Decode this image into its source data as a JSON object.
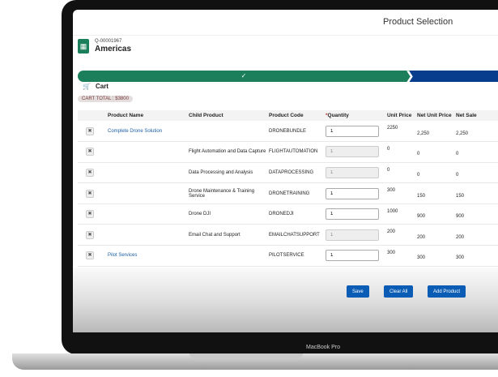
{
  "header": {
    "title": "Product Selection"
  },
  "record": {
    "quote_number": "Q-00001967",
    "account": "Americas"
  },
  "progress": {
    "completed_icon": "check-icon"
  },
  "cart": {
    "label": "Cart",
    "total": "CART TOTAL : $3800"
  },
  "table": {
    "columns": [
      "",
      "Product Name",
      "Child Product",
      "Product Code",
      "Quantity",
      "Unit Price",
      "Net Unit Price",
      "Net Sale"
    ],
    "required_mark": "*",
    "rows": [
      {
        "product": "Complete Drone Solution",
        "child": "",
        "code": "DRONEBUNDLE",
        "qty": "1",
        "qty_editable": true,
        "unit": "2250",
        "net_unit": "2,250",
        "net_sale": "2,250"
      },
      {
        "product": "",
        "child": "Flight Automation and Data Capture",
        "code": "FLIGHTAUTOMATION",
        "qty": "1",
        "qty_editable": false,
        "unit": "0",
        "net_unit": "0",
        "net_sale": "0"
      },
      {
        "product": "",
        "child": "Data Processing and Analysis",
        "code": "DATAPROCESSING",
        "qty": "1",
        "qty_editable": false,
        "unit": "0",
        "net_unit": "0",
        "net_sale": "0"
      },
      {
        "product": "",
        "child": "Drone Maintenance & Training Service",
        "code": "DRONETRAINING",
        "qty": "1",
        "qty_editable": true,
        "unit": "300",
        "net_unit": "150",
        "net_sale": "150"
      },
      {
        "product": "",
        "child": "Drone DJI",
        "code": "DRONEDJI",
        "qty": "1",
        "qty_editable": true,
        "unit": "1000",
        "net_unit": "900",
        "net_sale": "900"
      },
      {
        "product": "",
        "child": "Email Chat and Support",
        "code": "EMAILCHATSUPPORT",
        "qty": "1",
        "qty_editable": false,
        "unit": "200",
        "net_unit": "200",
        "net_sale": "200"
      },
      {
        "product": "Pilot Services",
        "child": "",
        "code": "PILOTSERVICE",
        "qty": "1",
        "qty_editable": true,
        "unit": "300",
        "net_unit": "300",
        "net_sale": "300"
      }
    ]
  },
  "footer": {
    "save": "Save",
    "clear": "Clear All",
    "add": "Add Product"
  },
  "device": {
    "label": "MacBook Pro"
  }
}
